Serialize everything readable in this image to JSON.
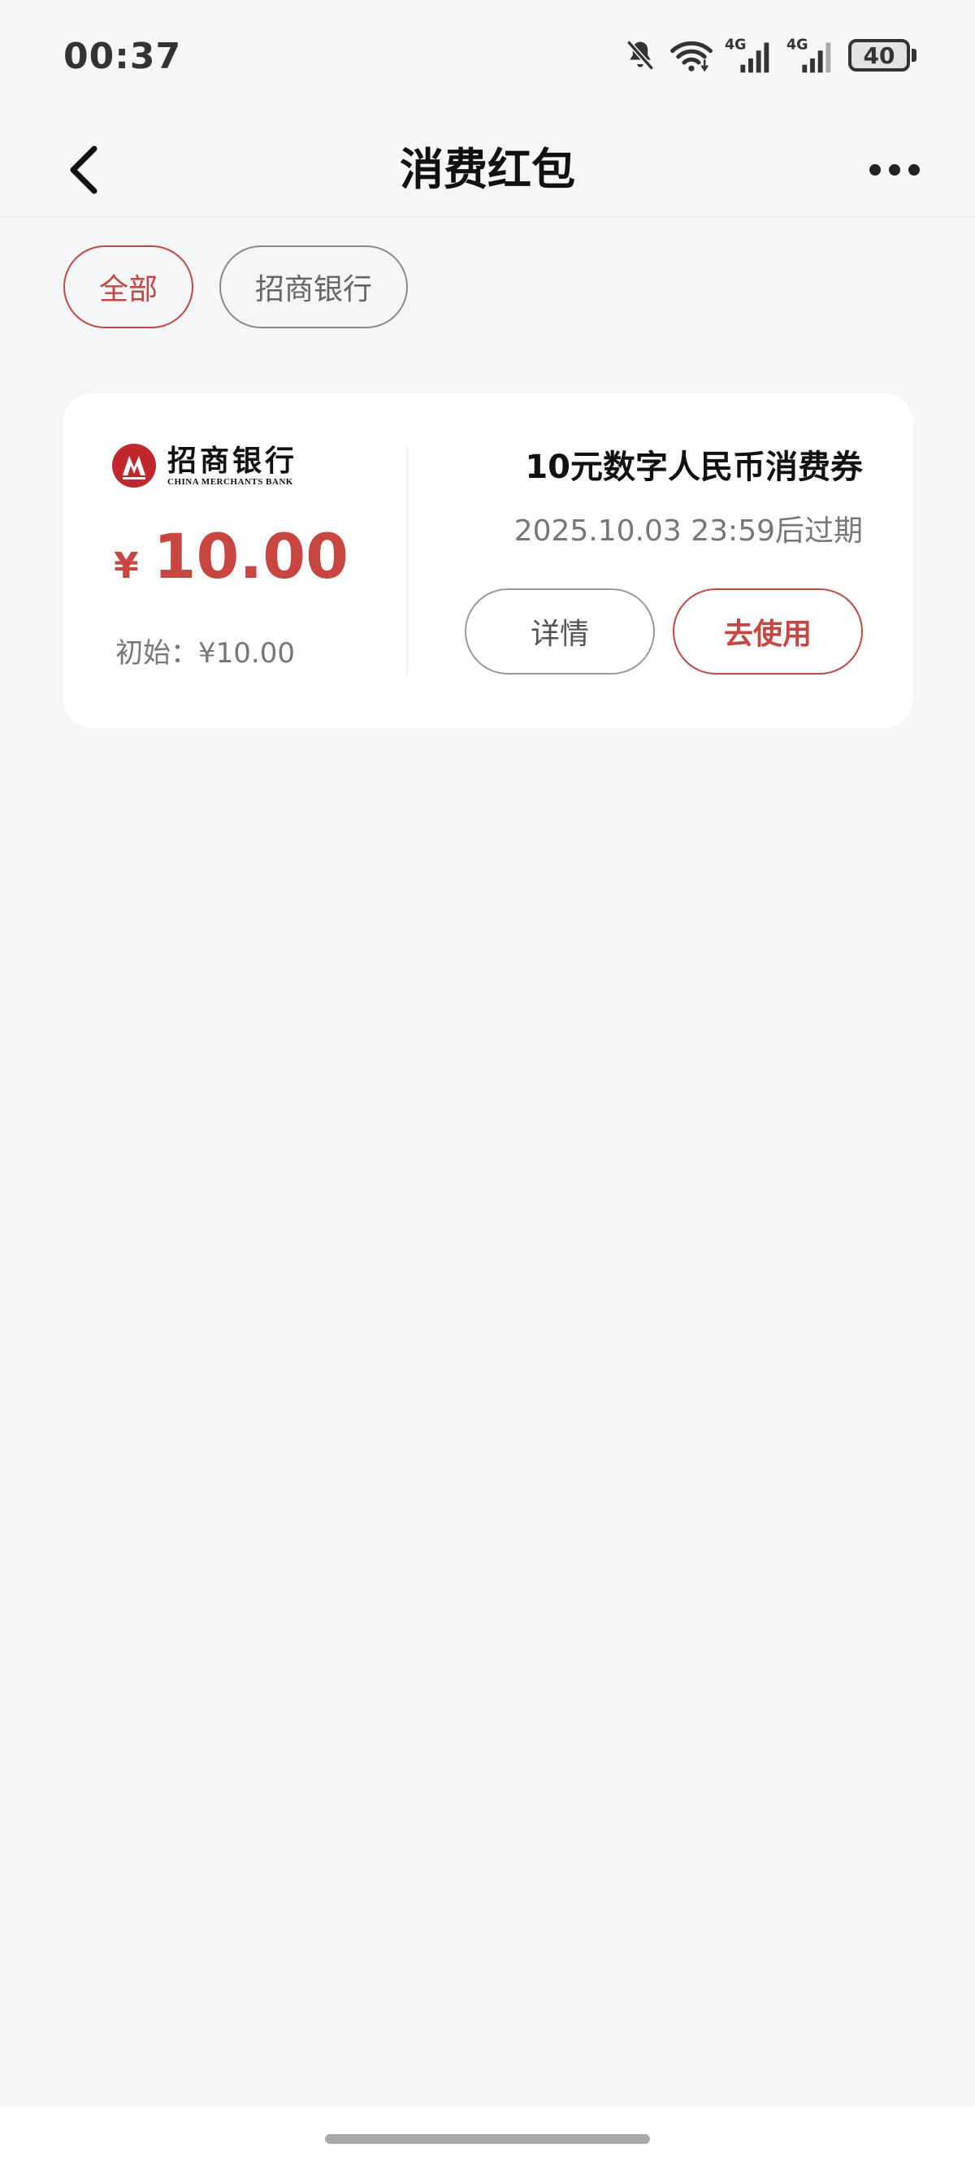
{
  "status_bar": {
    "time": "00:37",
    "battery": "40",
    "network_1": "4G",
    "network_2": "4G",
    "icons": [
      "bell-off-icon",
      "wifi-icon",
      "signal-icon",
      "signal-icon",
      "battery-icon"
    ]
  },
  "header": {
    "title": "消费红包",
    "back_icon": "chevron-left-icon",
    "more_icon": "more-horizontal-icon"
  },
  "filters": [
    {
      "label": "全部",
      "selected": true
    },
    {
      "label": "招商银行",
      "selected": false
    }
  ],
  "coupon": {
    "bank_name_cn": "招商银行",
    "bank_name_en": "CHINA MERCHANTS BANK",
    "currency_symbol": "¥",
    "amount": "10.00",
    "initial_amount": "初始：¥10.00",
    "title": "10元数字人民币消费券",
    "expiry": "2025.10.03 23:59后过期",
    "detail_label": "详情",
    "use_label": "去使用"
  },
  "colors": {
    "accent": "#c8463f",
    "bank_red": "#c1272d",
    "background": "#f5f6f8"
  }
}
